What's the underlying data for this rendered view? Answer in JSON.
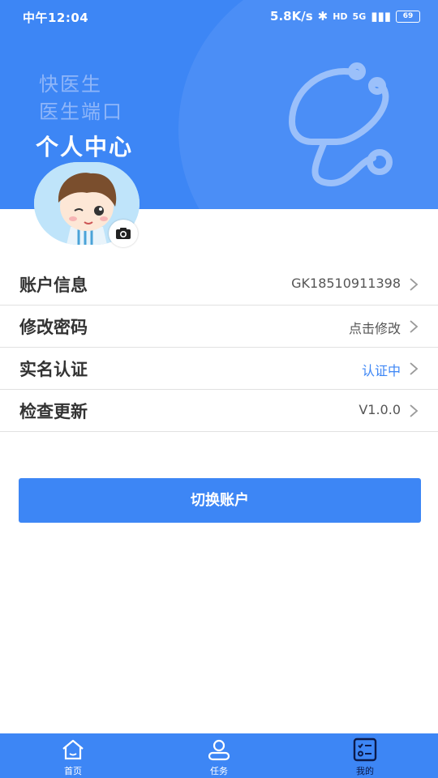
{
  "status_bar": {
    "time": "中午12:04",
    "network_speed": "5.8K/s",
    "hd": "HD",
    "signal": "5G",
    "battery": "69"
  },
  "header": {
    "brand_line1": "快医生",
    "brand_line2": "医生端口",
    "title": "个人中心"
  },
  "menu": [
    {
      "label": "账户信息",
      "value": "GK18510911398"
    },
    {
      "label": "修改密码",
      "value": "点击修改"
    },
    {
      "label": "实名认证",
      "value": "认证中"
    },
    {
      "label": "检查更新",
      "value": "V1.0.0"
    }
  ],
  "switch_account_label": "切换账户",
  "tabs": [
    {
      "label": "首页",
      "icon": "home-icon"
    },
    {
      "label": "任务",
      "icon": "user-icon"
    },
    {
      "label": "我的",
      "icon": "checklist-icon",
      "active": true
    }
  ],
  "colors": {
    "primary": "#3d86f5",
    "active_tab": "#0c1a4a"
  }
}
